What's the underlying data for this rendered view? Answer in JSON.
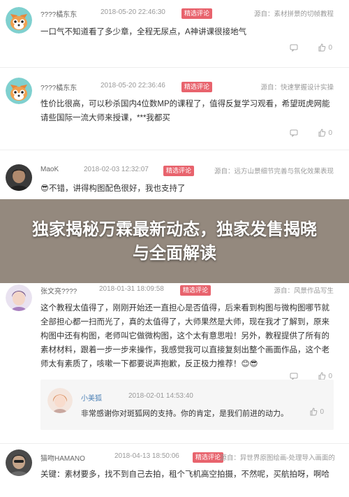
{
  "overlay_title": "独家揭秘万霖最新动态，独家发售揭晓与全面解读",
  "comments": [
    {
      "user": "????橘东东",
      "date": "2018-05-20 22:46:30",
      "badge": "精选评论",
      "source": "源自：素材拼景的切帧教程",
      "text": "一口气不知道看了多少章，全程无尿点，A神讲课很接地气",
      "likes": "0",
      "avatar": "fox"
    },
    {
      "user": "????橘东东",
      "date": "2018-05-20 22:36:46",
      "badge": "精选评论",
      "source": "源自：快速掌握设计实操",
      "text": "性价比很高，可以秒杀国内4位数MP的课程了，值得反复学习观看，希望斑虎网能请些国际一流大师来授课，***我都买",
      "likes": "0",
      "avatar": "fox"
    },
    {
      "user": "MaoK",
      "date": "2018-02-03 12:32:07",
      "badge": "精选评论",
      "source": "源自：远方山景细节完善与氛化效果表现",
      "text": "😎不错，讲得构图配色很好，我也支持了",
      "likes": "0",
      "avatar": "man"
    },
    {
      "user": "张文亮????",
      "date": "2018-01-31 18:09:58",
      "badge": "精选评论",
      "source": "源自：风景作品写生",
      "text": "这个教程太值得了，刚刚开始还一直担心是否值得，后来看到构图与微构图哪节就全部担心都一扫而光了，真的太值得了，大师果然是大师，现在我才了解到，原来构图中还有构图，老师叫它做微构图，这个太有意思啦！另外，教程提供了所有的素材材料，跟着一步一步来操作，我感觉我可以直接复刻出整个画面作品，这个老师太有素质了，咳嗽一下都要说声抱歉，反正极力推荐！😊😎",
      "likes": "0",
      "avatar": "lady"
    },
    {
      "user": "猫吻HAMANO",
      "date": "2018-04-13 18:50:06",
      "badge": "精选评论",
      "source": "源自：异世界原图绘画-处理导入画面的",
      "text": "关键：素材要多，找不到自己去拍，租个飞机高空拍摄，不然呢，买航拍呀，啊哈",
      "likes": "",
      "avatar": "man2"
    }
  ],
  "reply": {
    "user": "小美狐",
    "date": "2018-02-01 14:53:40",
    "text": "非常感谢你对斑狐网的支持。你的肯定，是我们前进的动力。",
    "likes": "0"
  },
  "colors": {
    "badge": "#e8636d",
    "overlay": "rgba(60,40,20,0.55)"
  }
}
